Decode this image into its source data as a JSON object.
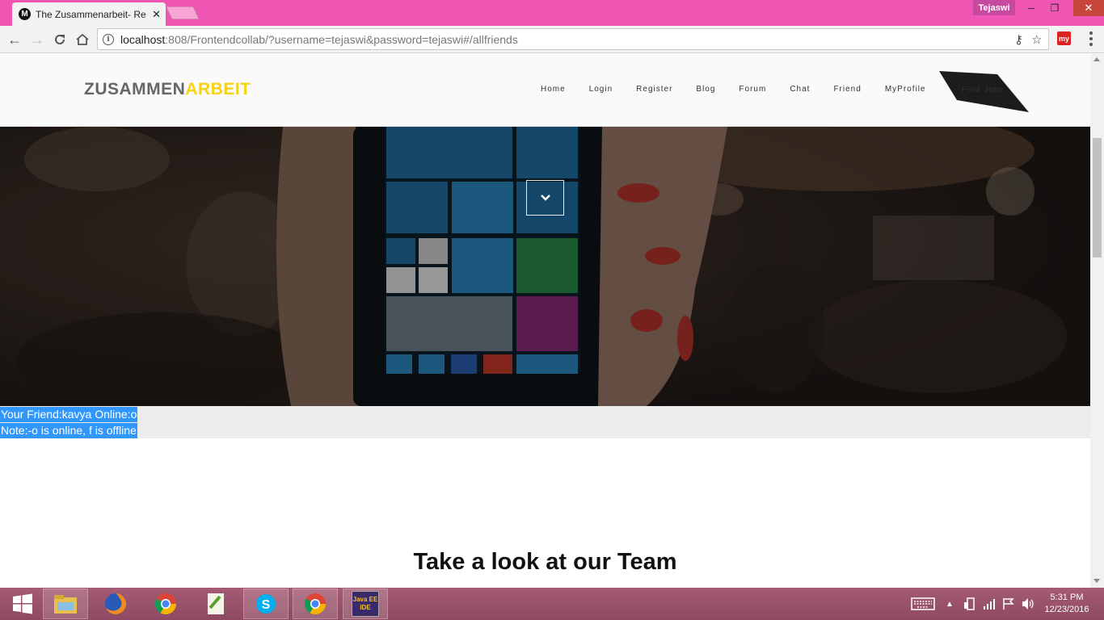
{
  "browser": {
    "tab_title": "The Zusammenarbeit- Re",
    "tab_favicon": "M",
    "profile_name": "Tejaswi",
    "url_host": "localhost",
    "url_rest": ":808/Frontendcollab/?username=tejaswi&password=tejaswi#/allfriends",
    "extension_label": "my",
    "info_glyph": "i"
  },
  "site": {
    "logo_part1": "ZUSAMMEN",
    "logo_part2": "ARBEIT",
    "nav": [
      "Home",
      "Login",
      "Register",
      "Blog",
      "Forum",
      "Chat",
      "Friend",
      "MyProfile"
    ],
    "find_jobs": "Find Jobs"
  },
  "friends": {
    "line1": "Your Friend:kavya Online:o",
    "line2": "Note:-o is online, f is offline"
  },
  "team": {
    "heading_plain": "Take a look at ",
    "heading_bold": "our Team"
  },
  "taskbar": {
    "time": "5:31 PM",
    "date": "12/23/2016",
    "java_label": "Java EE IDE"
  },
  "colors": {
    "titlebar": "#ef55b2",
    "logo_accent": "#f5d315",
    "selection": "#3297fd"
  }
}
